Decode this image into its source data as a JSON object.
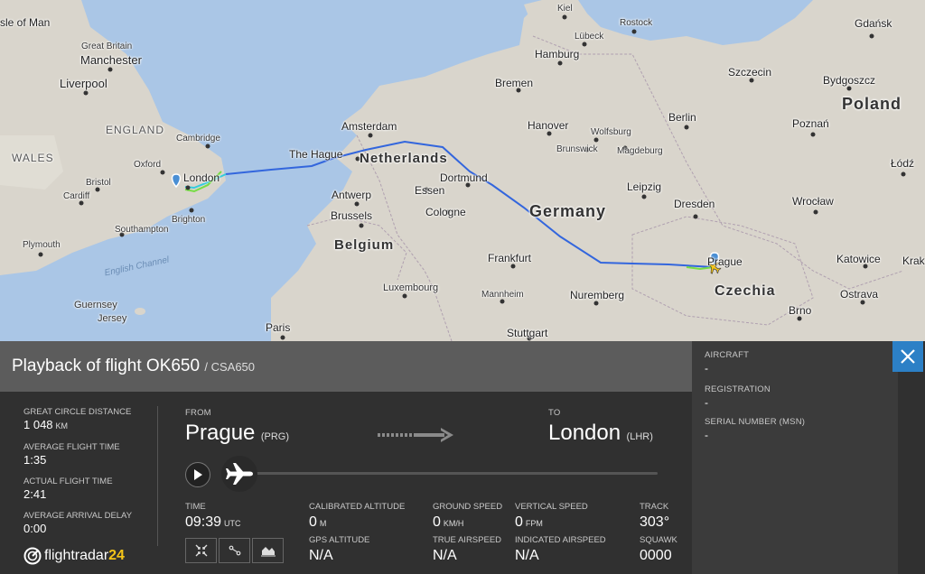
{
  "map": {
    "labels": {
      "isle_of_man": "sle of Man",
      "great_britain": "Great Britain",
      "manchester": "Manchester",
      "liverpool": "Liverpool",
      "england": "ENGLAND",
      "cambridge": "Cambridge",
      "wales": "WALES",
      "oxford": "Oxford",
      "london": "London",
      "bristol": "Bristol",
      "cardiff": "Cardiff",
      "brighton": "Brighton",
      "southampton": "Southampton",
      "plymouth": "Plymouth",
      "english_channel": "English Channel",
      "guernsey": "Guernsey",
      "jersey": "Jersey",
      "paris": "Paris",
      "amsterdam": "Amsterdam",
      "the_hague": "The Hague",
      "netherlands": "Netherlands",
      "antwerp": "Antwerp",
      "brussels": "Brussels",
      "belgium": "Belgium",
      "luxembourg": "Luxembourg",
      "essen": "Essen",
      "dortmund": "Dortmund",
      "cologne": "Cologne",
      "frankfurt": "Frankfurt",
      "mannheim": "Mannheim",
      "stuttgart": "Stuttgart",
      "nuremberg": "Nuremberg",
      "germany": "Germany",
      "bremen": "Bremen",
      "hamburg": "Hamburg",
      "kiel": "Kiel",
      "lubeck": "Lübeck",
      "rostock": "Rostock",
      "hanover": "Hanover",
      "wolfsburg": "Wolfsburg",
      "brunswick": "Brunswick",
      "magdeburg": "Magdeburg",
      "berlin": "Berlin",
      "leipzig": "Leipzig",
      "dresden": "Dresden",
      "prague": "Prague",
      "czechia": "Czechia",
      "brno": "Brno",
      "ostrava": "Ostrava",
      "katowice": "Katowice",
      "krakow": "Krak",
      "wroclaw": "Wrocław",
      "lodz": "Łódź",
      "poznan": "Poznań",
      "poland": "Poland",
      "bydgoszcz": "Bydgoszcz",
      "szczecin": "Szczecin",
      "gdansk": "Gdańsk"
    }
  },
  "panel": {
    "title": "Playback of flight OK650",
    "subtitle": "/ CSA650",
    "stats": {
      "distance_label": "GREAT CIRCLE DISTANCE",
      "distance_value": "1 048",
      "distance_unit": "KM",
      "avg_time_label": "AVERAGE FLIGHT TIME",
      "avg_time_value": "1:35",
      "actual_time_label": "ACTUAL FLIGHT TIME",
      "actual_time_value": "2:41",
      "delay_label": "AVERAGE ARRIVAL DELAY",
      "delay_value": "0:00"
    },
    "route": {
      "from_label": "FROM",
      "from_city": "Prague",
      "from_code": "(PRG)",
      "to_label": "TO",
      "to_city": "London",
      "to_code": "(LHR)"
    },
    "progress": 0.0,
    "data": {
      "time_label": "TIME",
      "time_value": "09:39",
      "time_unit": "UTC",
      "cal_alt_label": "CALIBRATED ALTITUDE",
      "cal_alt_value": "0",
      "cal_alt_unit": "M",
      "gps_alt_label": "GPS ALTITUDE",
      "gps_alt_value": "N/A",
      "ground_speed_label": "GROUND SPEED",
      "ground_speed_value": "0",
      "ground_speed_unit": "KM/H",
      "true_airspeed_label": "TRUE AIRSPEED",
      "true_airspeed_value": "N/A",
      "vertical_speed_label": "VERTICAL SPEED",
      "vertical_speed_value": "0",
      "vertical_speed_unit": "FPM",
      "indicated_airspeed_label": "INDICATED AIRSPEED",
      "indicated_airspeed_value": "N/A",
      "track_label": "TRACK",
      "track_value": "303°",
      "squawk_label": "SQUAWK",
      "squawk_value": "0000"
    },
    "aircraft": {
      "aircraft_label": "AIRCRAFT",
      "aircraft_value": "-",
      "registration_label": "REGISTRATION",
      "registration_value": "-",
      "serial_label": "SERIAL NUMBER (MSN)",
      "serial_value": "-"
    },
    "brand": {
      "name": "flightradar",
      "number": "24"
    }
  },
  "colors": {
    "accent_blue": "#2c80c6",
    "panel_bg": "#303030",
    "title_bar": "#5c5c5c",
    "track_blue": "#3366dd",
    "track_green": "#77dd44",
    "brand_yellow": "#f5c518"
  },
  "icons": [
    "close-icon",
    "play-icon",
    "airplane-icon",
    "arrow-right-icon",
    "expand-icon",
    "route-icon",
    "chart-icon",
    "flightradar-logo-icon",
    "airport-pin-icon"
  ]
}
